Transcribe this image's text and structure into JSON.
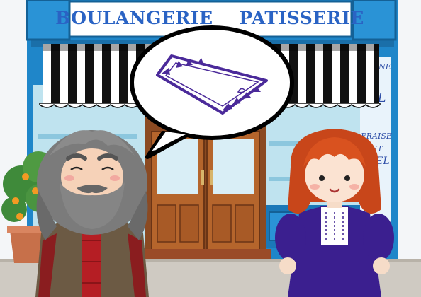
{
  "shop_sign": {
    "text": "BOULANGERIE    PATISSERIE"
  },
  "window_lettering": {
    "line_1": "HAINE",
    "line_2": "EL",
    "line_3": "FRAISE",
    "line_4": "ET",
    "line_5": "MIEL"
  },
  "speech_bubble": {
    "icon": "square-picture-frame-icon"
  },
  "colors": {
    "storefront": "#1f86c9",
    "sign_text": "#2a63c4",
    "frame_stroke": "#4b2a9a",
    "door_wood": "#b5652c",
    "girl_dress": "#3b1f8f",
    "girl_hair": "#c8461a",
    "man_hair": "#7b7b7b",
    "man_scarf": "#b51e24",
    "man_coat": "#6c5a44"
  },
  "characters": [
    "old-man-character",
    "girl-character"
  ]
}
